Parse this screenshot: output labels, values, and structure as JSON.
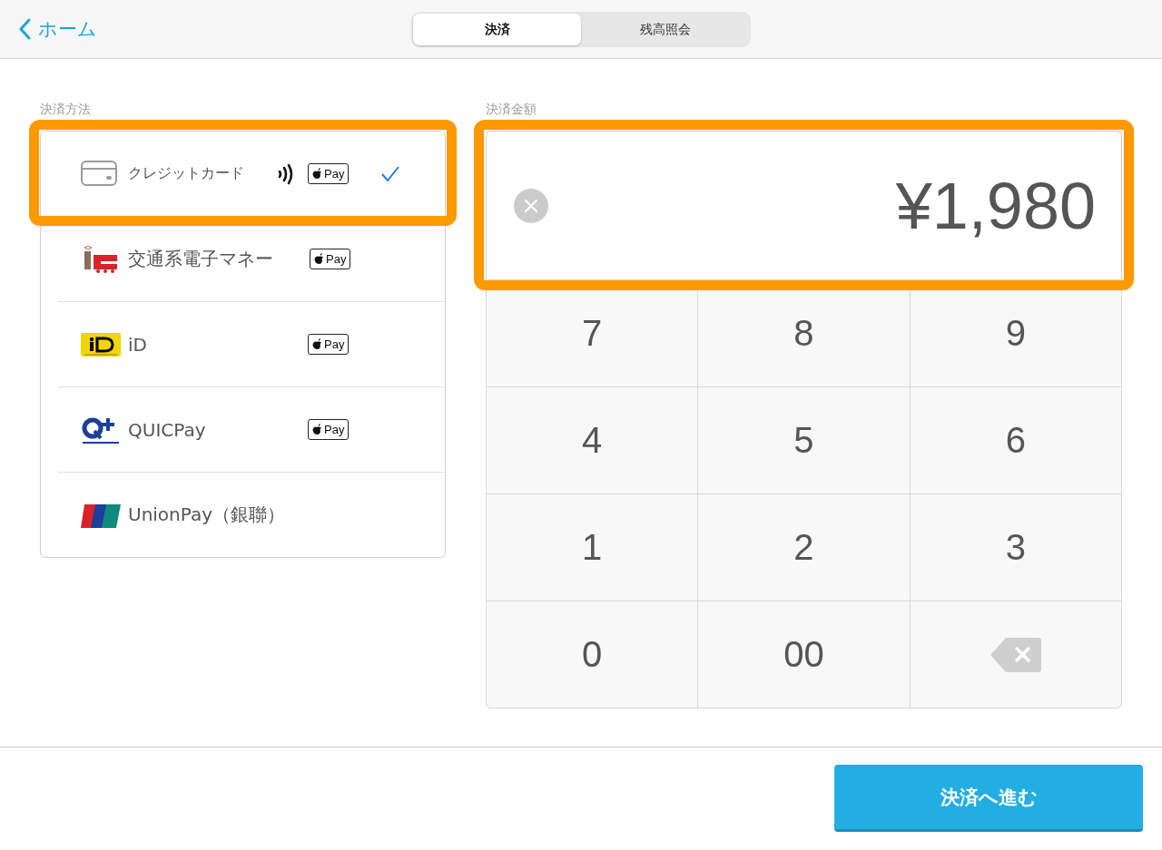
{
  "header": {
    "back": {
      "label": "ホーム"
    },
    "tabs": [
      {
        "label": "決済",
        "selected": true
      },
      {
        "label": "残高照会",
        "selected": false
      }
    ]
  },
  "methods": {
    "label": "決済方法",
    "highlighted": true,
    "items": [
      {
        "label": "クレジットカード",
        "contactless": true,
        "badge": "Pay",
        "selected": true
      },
      {
        "label": "交通系電子マネー",
        "contactless": false,
        "badge": "Pay",
        "selected": false
      },
      {
        "label": "iD",
        "contactless": false,
        "badge": "Pay",
        "selected": false
      },
      {
        "label": "QUICPay",
        "contactless": false,
        "badge": "Pay",
        "selected": false
      },
      {
        "label": "UnionPay（銀聯）",
        "contactless": false,
        "selected": false
      }
    ]
  },
  "amount": {
    "label": "決済金額",
    "value": "¥1,980",
    "highlighted": true
  },
  "keypad": [
    {
      "kind": "digit",
      "label": "7"
    },
    {
      "kind": "digit",
      "label": "8"
    },
    {
      "kind": "digit",
      "label": "9"
    },
    {
      "kind": "digit",
      "label": "4"
    },
    {
      "kind": "digit",
      "label": "5"
    },
    {
      "kind": "digit",
      "label": "6"
    },
    {
      "kind": "digit",
      "label": "1"
    },
    {
      "kind": "digit",
      "label": "2"
    },
    {
      "kind": "digit",
      "label": "3"
    },
    {
      "kind": "digit",
      "label": "0"
    },
    {
      "kind": "digit",
      "label": "00"
    },
    {
      "kind": "backspace"
    }
  ],
  "footer": {
    "button": "決済へ進む"
  }
}
